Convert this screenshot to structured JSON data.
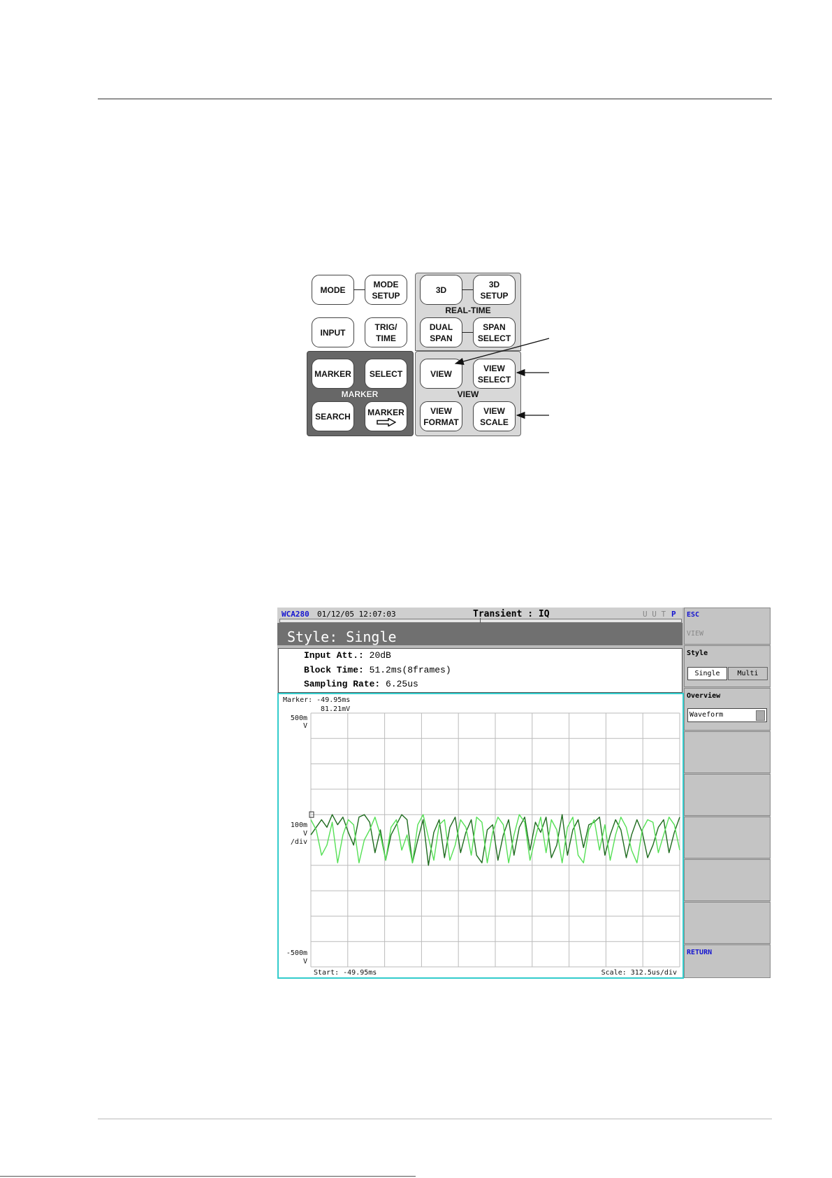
{
  "keypad": {
    "mode": "MODE",
    "mode_setup": "MODE\nSETUP",
    "input": "INPUT",
    "trig_time": "TRIG/\nTIME",
    "marker": "MARKER",
    "select": "SELECT",
    "marker_group": "MARKER",
    "search": "SEARCH",
    "marker_to": "MARKER",
    "key_3d": "3D",
    "key_3d_setup": "3D\nSETUP",
    "realtime_group": "REAL-TIME",
    "dual_span": "DUAL\nSPAN",
    "span_select": "SPAN\nSELECT",
    "view": "VIEW",
    "view_select": "VIEW\nSELECT",
    "view_group": "VIEW",
    "view_format": "VIEW\nFORMAT",
    "view_scale": "VIEW\nSCALE"
  },
  "screen": {
    "model": "WCA280",
    "datetime": "01/12/05 12:07:03",
    "mode_title": "Transient : IQ",
    "status_dim": "U U T",
    "status_active": "P",
    "style_title": "Style: Single",
    "info": [
      {
        "label": "Input Att.:",
        "value": "20dB"
      },
      {
        "label": "Block Time:",
        "value": "51.2ms(8frames)"
      },
      {
        "label": "Sampling Rate:",
        "value": "6.25us"
      }
    ],
    "marker_label": "Marker: -49.95ms",
    "marker_value": "81.21mV",
    "y_top": "500m",
    "y_top_unit": "V",
    "y_mid": "100m",
    "y_mid_unit": "V",
    "y_mid_div": "/div",
    "y_bot": "-500m",
    "y_bot_unit": "V",
    "start": "Start: -49.95ms",
    "scale": "Scale: 312.5us/div"
  },
  "softkeys": {
    "esc": "ESC",
    "view": "VIEW",
    "style_label": "Style",
    "single": "Single",
    "multi": "Multi",
    "overview_label": "Overview",
    "overview_value": "Waveform",
    "return": "RETURN"
  },
  "colors": {
    "trace_i": "#1e6b1e",
    "trace_q": "#55e055",
    "screen_cyan": "#33cccc",
    "softkey_blue": "#1515d0"
  },
  "chart_data": {
    "type": "line",
    "ylim": [
      -0.5,
      0.5
    ],
    "y_ticks": [
      "500m",
      "100m",
      "-500m"
    ],
    "x_start_ms": -49.95,
    "x_scale_us_per_div": 312.5,
    "series": [
      {
        "values": [
          0.02,
          0.05,
          0.08,
          0.05,
          0.1,
          0.06,
          0.09,
          0.03,
          -0.02,
          0.09,
          0.1,
          0.07,
          -0.05,
          0.04,
          -0.08,
          0.02,
          0.06,
          0.1,
          0.08,
          -0.09,
          0.0,
          0.08,
          -0.1,
          0.03,
          0.08,
          -0.07,
          0.05,
          0.09,
          -0.05,
          0.03,
          0.08,
          -0.06,
          -0.09,
          0.04,
          0.06,
          -0.08,
          0.02,
          0.08,
          -0.06,
          0.05,
          0.09,
          -0.04,
          0.07,
          0.03,
          0.09,
          -0.07,
          -0.02,
          0.1,
          -0.06,
          0.04,
          0.08,
          -0.03,
          0.06,
          0.07,
          0.09,
          -0.06,
          0.02,
          0.08,
          0.04,
          -0.07,
          0.02,
          0.08,
          0.03,
          -0.07,
          -0.02,
          0.05,
          0.08,
          -0.05,
          0.03,
          0.09
        ]
      },
      {
        "values": [
          0.08,
          0.04,
          -0.06,
          -0.02,
          0.07,
          -0.09,
          0.02,
          0.08,
          0.06,
          -0.09,
          0.0,
          0.04,
          0.09,
          0.02,
          -0.08,
          0.05,
          0.08,
          -0.04,
          0.02,
          -0.09,
          0.06,
          0.1,
          0.01,
          -0.08,
          0.06,
          0.08,
          -0.08,
          -0.02,
          0.08,
          0.05,
          -0.06,
          0.09,
          0.07,
          -0.09,
          0.03,
          0.09,
          0.06,
          -0.09,
          0.02,
          0.1,
          0.07,
          -0.08,
          0.01,
          0.09,
          -0.05,
          0.08,
          0.04,
          -0.09,
          0.05,
          0.09,
          -0.06,
          -0.09,
          0.04,
          0.08,
          -0.04,
          0.06,
          -0.08,
          0.02,
          0.09,
          0.05,
          -0.04,
          -0.09,
          0.04,
          0.08,
          0.07,
          -0.05,
          0.02,
          0.09,
          0.06,
          -0.04
        ]
      }
    ]
  }
}
